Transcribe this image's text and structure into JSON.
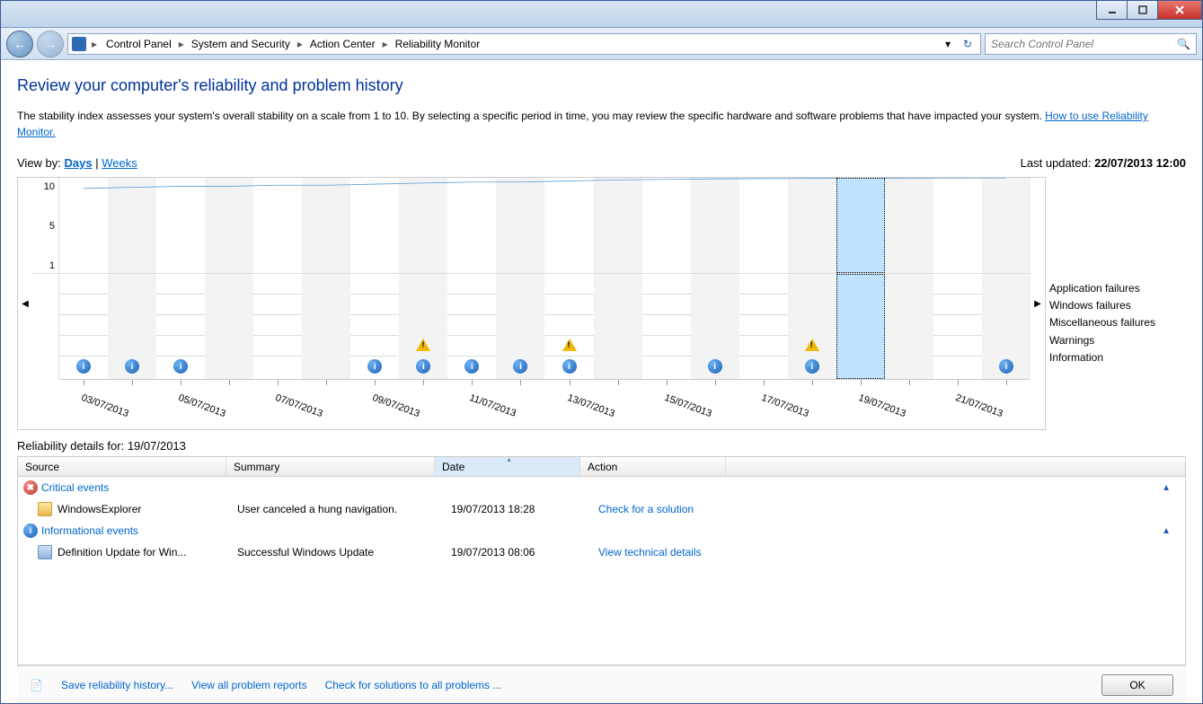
{
  "breadcrumbs": [
    "Control Panel",
    "System and Security",
    "Action Center",
    "Reliability Monitor"
  ],
  "search": {
    "placeholder": "Search Control Panel"
  },
  "page_title": "Review your computer's reliability and problem history",
  "description": "The stability index assesses your system's overall stability on a scale from 1 to 10. By selecting a specific period in time, you may review the specific hardware and software problems that have impacted your system.",
  "help_link": "How to use Reliability Monitor.",
  "view_by": {
    "label": "View by:",
    "days": "Days",
    "weeks": "Weeks",
    "sep": "|"
  },
  "last_updated": {
    "prefix": "Last updated: ",
    "value": "22/07/2013 12:00"
  },
  "legend": {
    "app_failures": "Application failures",
    "win_failures": "Windows failures",
    "misc_failures": "Miscellaneous failures",
    "warnings": "Warnings",
    "information": "Information"
  },
  "yaxis": {
    "max": "10",
    "mid": "5",
    "min": "1"
  },
  "details_for": {
    "prefix": "Reliability details for: ",
    "date": "19/07/2013"
  },
  "columns": {
    "source": "Source",
    "summary": "Summary",
    "date": "Date",
    "action": "Action"
  },
  "groups": {
    "critical": "Critical events",
    "informational": "Informational events"
  },
  "rows": {
    "crit1": {
      "source": "WindowsExplorer",
      "summary": "User canceled a hung navigation.",
      "date": "19/07/2013 18:28",
      "action": "Check for a solution"
    },
    "info1": {
      "source": "Definition Update for Win...",
      "summary": "Successful Windows Update",
      "date": "19/07/2013 08:06",
      "action": "View  technical details"
    }
  },
  "footer": {
    "save": "Save reliability history...",
    "view_all": "View all problem reports",
    "check": "Check for solutions to all problems ...",
    "ok": "OK"
  },
  "chart_data": {
    "type": "line",
    "title": "Stability index",
    "ylim": [
      1,
      10
    ],
    "dates": [
      "03/07/2013",
      "04/07/2013",
      "05/07/2013",
      "06/07/2013",
      "07/07/2013",
      "08/07/2013",
      "09/07/2013",
      "10/07/2013",
      "11/07/2013",
      "12/07/2013",
      "13/07/2013",
      "14/07/2013",
      "15/07/2013",
      "16/07/2013",
      "17/07/2013",
      "18/07/2013",
      "19/07/2013",
      "20/07/2013",
      "21/07/2013",
      "22/07/2013"
    ],
    "xticks_labeled": [
      "03/07/2013",
      "05/07/2013",
      "07/07/2013",
      "09/07/2013",
      "11/07/2013",
      "13/07/2013",
      "15/07/2013",
      "17/07/2013",
      "19/07/2013",
      "21/07/2013"
    ],
    "stability": [
      9.0,
      9.1,
      9.2,
      9.2,
      9.3,
      9.3,
      9.4,
      9.5,
      9.6,
      9.6,
      9.7,
      9.8,
      9.85,
      9.9,
      9.92,
      9.94,
      9.96,
      9.97,
      9.98,
      9.99
    ],
    "selected_index": 16,
    "events": {
      "application_failures": [
        16
      ],
      "windows_failures": [],
      "miscellaneous_failures": [],
      "warnings": [
        7,
        10,
        15
      ],
      "information": [
        0,
        1,
        2,
        6,
        7,
        8,
        9,
        10,
        13,
        15,
        16,
        19
      ]
    }
  }
}
